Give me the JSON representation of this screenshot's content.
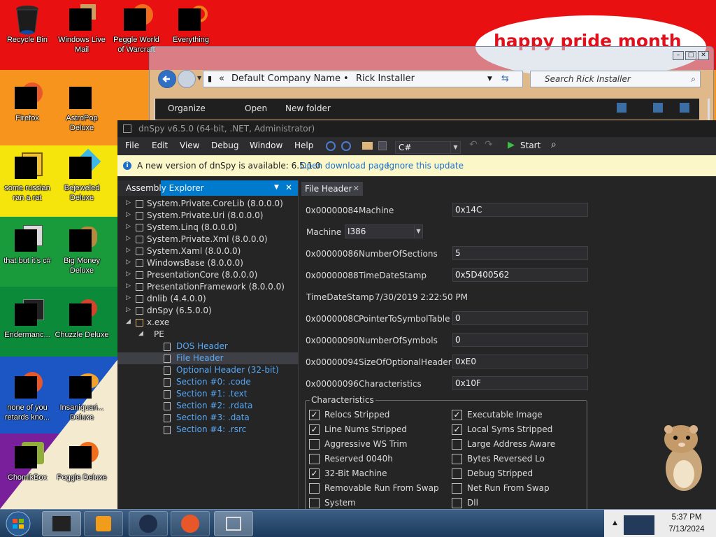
{
  "desktop": {
    "cloud_text": "happy pride month",
    "icons": [
      {
        "label": "Recycle Bin"
      },
      {
        "label": "Windows Live Mail"
      },
      {
        "label": "Peggle World of Warcraft"
      },
      {
        "label": "Everything"
      },
      {
        "label": "Firefox"
      },
      {
        "label": "AstroPop Deluxe"
      },
      {
        "label": "some russian ran a rat"
      },
      {
        "label": "Bejeweled Deluxe"
      },
      {
        "label": "that but it's c#"
      },
      {
        "label": "Big Money Deluxe"
      },
      {
        "label": "Endermanc..."
      },
      {
        "label": "Chuzzle Deluxe"
      },
      {
        "label": "none of you retards kno..."
      },
      {
        "label": "Insaniquari... Deluxe"
      },
      {
        "label": "ChomikBox"
      },
      {
        "label": "Peggle Deluxe"
      }
    ]
  },
  "explorer": {
    "breadcrumb_sep": "«",
    "crumb1": "Default Company Name",
    "bullet": "•",
    "crumb2": "Rick Installer",
    "search_placeholder": "Search Rick Installer",
    "toolbar": {
      "organize": "Organize",
      "open": "Open",
      "new_folder": "New folder"
    }
  },
  "dnspy": {
    "title": "dnSpy v6.5.0 (64-bit, .NET, Administrator)",
    "menu": [
      "File",
      "Edit",
      "View",
      "Debug",
      "Window",
      "Help"
    ],
    "language": "C#",
    "start_label": "Start",
    "info": {
      "message": "A new version of dnSpy is available: 6.5.1.0",
      "open_link": "Open download page",
      "ignore_link": "Ignore this update"
    },
    "assembly_explorer": {
      "title": "Assembly Explorer",
      "items": [
        {
          "text": "System.Private.CoreLib (8.0.0.0)"
        },
        {
          "text": "System.Private.Uri (8.0.0.0)"
        },
        {
          "text": "System.Linq (8.0.0.0)"
        },
        {
          "text": "System.Private.Xml (8.0.0.0)"
        },
        {
          "text": "System.Xaml (8.0.0.0)"
        },
        {
          "text": "WindowsBase (8.0.0.0)"
        },
        {
          "text": "PresentationCore (8.0.0.0)"
        },
        {
          "text": "PresentationFramework (8.0.0.0)"
        },
        {
          "text": "dnlib (4.4.0.0)"
        },
        {
          "text": "dnSpy (6.5.0.0)"
        },
        {
          "text": "x.exe"
        },
        {
          "text": "PE"
        },
        {
          "text": "DOS Header"
        },
        {
          "text": "File Header"
        },
        {
          "text": "Optional Header (32-bit)"
        },
        {
          "text": "Section #0: .code"
        },
        {
          "text": "Section #1: .text"
        },
        {
          "text": "Section #2: .rdata"
        },
        {
          "text": "Section #3: .data"
        },
        {
          "text": "Section #4: .rsrc"
        }
      ]
    },
    "file_header": {
      "tab": "File Header",
      "rows": {
        "machine": {
          "offset": "0x00000084",
          "name": "Machine",
          "value": "0x14C"
        },
        "machine_combo_label": "Machine",
        "machine_combo_value": "I386",
        "sections": {
          "offset": "0x00000086",
          "name": "NumberOfSections",
          "value": "5"
        },
        "timestamp": {
          "offset": "0x00000088",
          "name": "TimeDateStamp",
          "value": "0x5D400562"
        },
        "timestamp_label": "TimeDateStamp",
        "timestamp_text": "7/30/2019 2:22:50 PM",
        "symtab": {
          "offset": "0x0000008C",
          "name": "PointerToSymbolTable",
          "value": "0"
        },
        "numsym": {
          "offset": "0x00000090",
          "name": "NumberOfSymbols",
          "value": "0"
        },
        "optsize": {
          "offset": "0x00000094",
          "name": "SizeOfOptionalHeader",
          "value": "0xE0"
        },
        "chars": {
          "offset": "0x00000096",
          "name": "Characteristics",
          "value": "0x10F"
        }
      },
      "characteristics": {
        "legend": "Characteristics",
        "items": [
          {
            "label": "Relocs Stripped",
            "checked": true
          },
          {
            "label": "Executable Image",
            "checked": true
          },
          {
            "label": "Line Nums Stripped",
            "checked": true
          },
          {
            "label": "Local Syms Stripped",
            "checked": true
          },
          {
            "label": "Aggressive WS Trim",
            "checked": false
          },
          {
            "label": "Large Address Aware",
            "checked": false
          },
          {
            "label": "Reserved 0040h",
            "checked": false
          },
          {
            "label": "Bytes Reversed Lo",
            "checked": false
          },
          {
            "label": "32-Bit Machine",
            "checked": true
          },
          {
            "label": "Debug Stripped",
            "checked": false
          },
          {
            "label": "Removable Run From Swap",
            "checked": false
          },
          {
            "label": "Net Run From Swap",
            "checked": false
          },
          {
            "label": "System",
            "checked": false
          },
          {
            "label": "Dll",
            "checked": false
          }
        ]
      }
    }
  },
  "taskbar": {
    "time": "5:37 PM",
    "date": "7/13/2024"
  }
}
